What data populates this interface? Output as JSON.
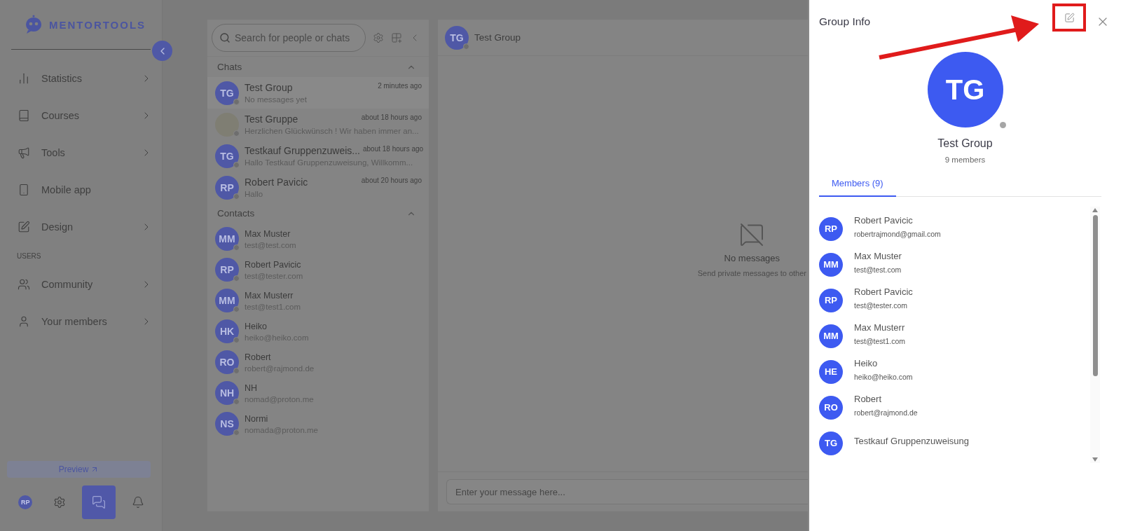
{
  "sidebar": {
    "logo": "MENTORTOOLS",
    "items": [
      {
        "label": "Statistics",
        "kind": "chart",
        "chevron": true
      },
      {
        "label": "Courses",
        "kind": "book",
        "chevron": true
      },
      {
        "label": "Tools",
        "kind": "megaphone",
        "chevron": true
      },
      {
        "label": "Mobile app",
        "kind": "phone",
        "chevron": false
      },
      {
        "label": "Design",
        "kind": "pen",
        "chevron": true
      }
    ],
    "section": "USERS",
    "user_items": [
      {
        "label": "Community",
        "kind": "people",
        "chevron": true
      },
      {
        "label": "Your members",
        "kind": "person",
        "chevron": true
      }
    ],
    "preview": "Preview",
    "bottom": [
      {
        "kind": "avatar",
        "initials": "RP",
        "selected": false
      },
      {
        "kind": "settings",
        "selected": false
      },
      {
        "kind": "chat",
        "selected": true
      },
      {
        "kind": "bell",
        "selected": false
      }
    ]
  },
  "chat_list": {
    "search": {
      "placeholder": "Search for people or chats"
    },
    "sections": [
      {
        "title": "Chats",
        "expanded": true,
        "items": [
          {
            "kind": "initials",
            "initials": "TG",
            "name": "Test Group",
            "preview": "No messages yet",
            "time": "2 minutes ago",
            "selected": true
          },
          {
            "kind": "photo",
            "name": "Test Gruppe",
            "preview": "Herzlichen Glückwünsch ! Wir haben immer an...",
            "time": "about 18 hours ago",
            "selected": false
          },
          {
            "kind": "initials",
            "initials": "TG",
            "name": "Testkauf Gruppenzuweis...",
            "preview": "Hallo Testkauf Gruppenzuweisung, Willkomm...",
            "time": "about 18 hours ago",
            "selected": false
          },
          {
            "kind": "initials",
            "initials": "RP",
            "name": "Robert Pavicic",
            "preview": "Hallo",
            "time": "about 20 hours ago",
            "selected": false
          }
        ]
      },
      {
        "title": "Contacts",
        "expanded": true,
        "items": [
          {
            "kind": "initials",
            "initials": "MM",
            "name": "Max Muster",
            "preview": "test@test.com",
            "selected": false
          },
          {
            "kind": "initials",
            "initials": "RP",
            "name": "Robert Pavicic",
            "preview": "test@tester.com",
            "selected": false
          },
          {
            "kind": "initials",
            "initials": "MM",
            "name": "Max Musterr",
            "preview": "test@test1.com",
            "selected": false
          },
          {
            "kind": "initials",
            "initials": "HK",
            "name": "Heiko",
            "preview": "heiko@heiko.com",
            "selected": false
          },
          {
            "kind": "initials",
            "initials": "RO",
            "name": "Robert",
            "preview": "robert@rajmond.de",
            "selected": false
          },
          {
            "kind": "initials",
            "initials": "NH",
            "name": "NH",
            "preview": "nomad@proton.me",
            "selected": false
          },
          {
            "kind": "initials",
            "initials": "NS",
            "name": "Normi",
            "preview": "nomada@proton.me",
            "selected": false
          }
        ]
      }
    ]
  },
  "conversation": {
    "initials": "TG",
    "title": "Test Group",
    "empty_title": "No messages",
    "empty_text": "Send private messages to other",
    "input": {
      "placeholder": "Enter your message here..."
    }
  },
  "group_info": {
    "title": "Group Info",
    "initials": "TG",
    "name": "Test Group",
    "count": "9 members",
    "tabs": [
      {
        "label": "Members (9)",
        "selected": true
      }
    ],
    "members": [
      {
        "initials": "RP",
        "name": "Robert Pavicic",
        "email": "robertrajmond@gmail.com"
      },
      {
        "initials": "MM",
        "name": "Max Muster",
        "email": "test@test.com"
      },
      {
        "initials": "RP",
        "name": "Robert Pavicic",
        "email": "test@tester.com"
      },
      {
        "initials": "MM",
        "name": "Max Musterr",
        "email": "test@test1.com"
      },
      {
        "initials": "HE",
        "name": "Heiko",
        "email": "heiko@heiko.com"
      },
      {
        "initials": "RO",
        "name": "Robert",
        "email": "robert@rajmond.de"
      },
      {
        "initials": "TG",
        "name": "Testkauf Gruppenzuweisung"
      }
    ]
  }
}
